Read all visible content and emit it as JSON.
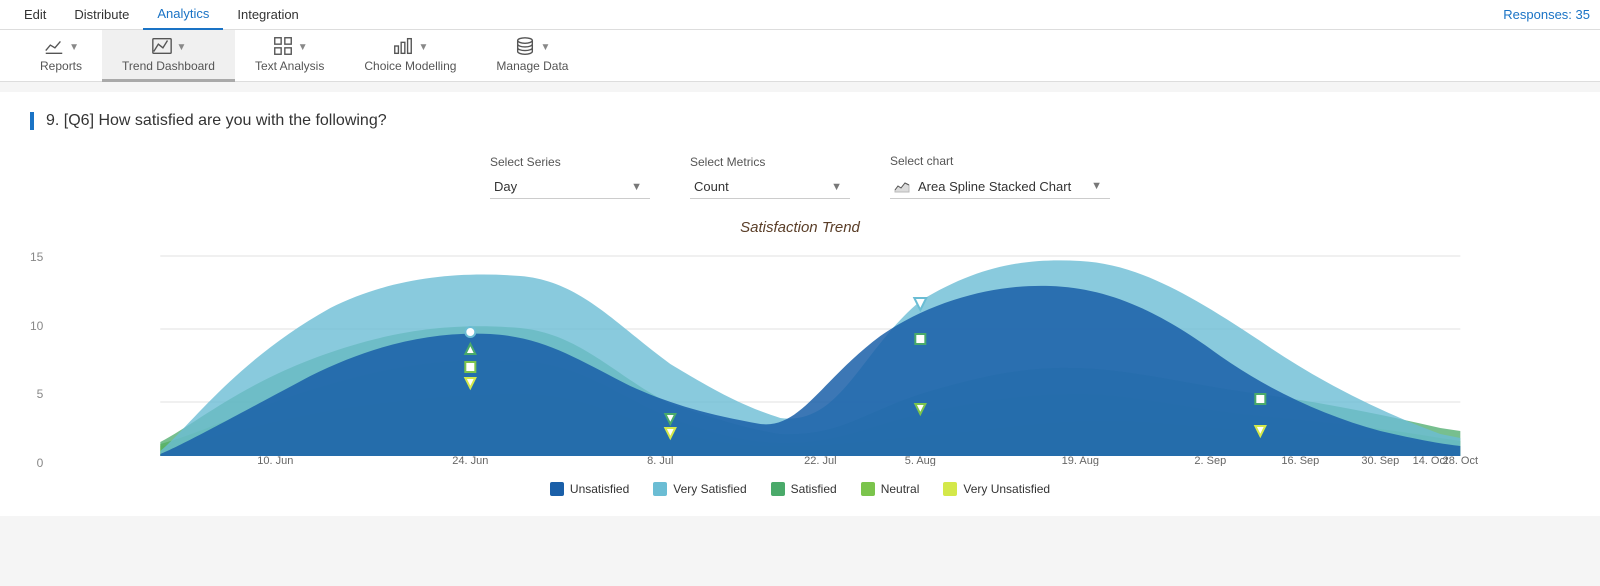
{
  "topnav": {
    "items": [
      {
        "label": "Edit",
        "active": false
      },
      {
        "label": "Distribute",
        "active": false
      },
      {
        "label": "Analytics",
        "active": true
      },
      {
        "label": "Integration",
        "active": false
      }
    ],
    "responses": "Responses: 35"
  },
  "secnav": {
    "items": [
      {
        "label": "Reports",
        "active": false,
        "icon": "chart-line"
      },
      {
        "label": "Trend Dashboard",
        "active": true,
        "icon": "trend"
      },
      {
        "label": "Text Analysis",
        "active": false,
        "icon": "grid"
      },
      {
        "label": "Choice Modelling",
        "active": false,
        "icon": "bar-chart"
      },
      {
        "label": "Manage Data",
        "active": false,
        "icon": "database"
      }
    ]
  },
  "question": {
    "title": "9. [Q6] How satisfied are you with the following?"
  },
  "controls": {
    "series_label": "Select Series",
    "series_value": "Day",
    "metrics_label": "Select Metrics",
    "metrics_value": "Count",
    "chart_label": "Select chart",
    "chart_value": "Area Spline Stacked Chart"
  },
  "chart": {
    "title": "Satisfaction Trend",
    "y_labels": [
      "0",
      "5",
      "10",
      "15"
    ],
    "x_labels": [
      "10. Jun",
      "24. Jun",
      "8. Jul",
      "22. Jul",
      "5. Aug",
      "19. Aug",
      "2. Sep",
      "16. Sep",
      "30. Sep",
      "14. Oct",
      "28. Oct"
    ]
  },
  "legend": {
    "items": [
      {
        "label": "Unsatisfied",
        "color": "#1a5fa8"
      },
      {
        "label": "Very Satisfied",
        "color": "#6bbdd4"
      },
      {
        "label": "Satisfied",
        "color": "#4aaa6a"
      },
      {
        "label": "Neutral",
        "color": "#7bc44c"
      },
      {
        "label": "Very Unsatisfied",
        "color": "#d4e84a"
      }
    ]
  }
}
